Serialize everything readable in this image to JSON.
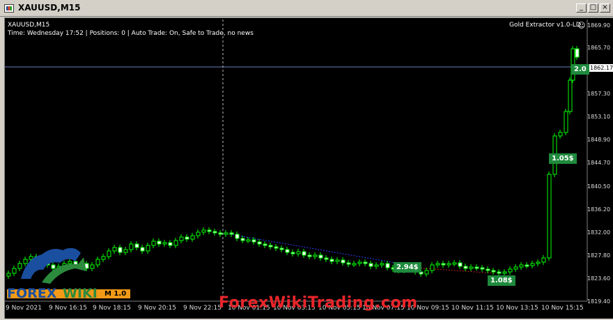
{
  "window": {
    "title": "XAUUSD,M15",
    "min_label": "_",
    "max_label": "□",
    "close_label": "×"
  },
  "chart": {
    "symbol_label": "XAUUSD,M15",
    "status_line": "Time: Wednesday 17:52 | Positions: 0 | Auto Trade: On, Safe to Trade, no news",
    "indicator_name": "Gold Extractor v1.0-LD",
    "price_axis": [
      "1869.90",
      "1865.70",
      "1862.1",
      "1857.30",
      "1853.10",
      "1848.90",
      "1844.70",
      "1840.50",
      "1836.20",
      "1832.00",
      "1827.80",
      "1823.60",
      "1819.40"
    ],
    "current_price": "1862.17",
    "time_axis": [
      "9 Nov 2021",
      "9 Nov 16:15",
      "9 Nov 18:15",
      "9 Nov 20:15",
      "9 Nov 22:15",
      "10 Nov 01:15",
      "10 Nov 03:15",
      "10 Nov 05:15",
      "10 Nov 07:15",
      "10 Nov 09:15",
      "10 Nov 11:15",
      "10 Nov 13:15",
      "10 Nov 15:15"
    ],
    "profit_badges": [
      "2.94$",
      "1.08$",
      "1.05$",
      "2.0"
    ],
    "ea_label": "M 1.0",
    "colors": {
      "background": "#000000",
      "bull_candle": "#00ff00",
      "bear_candle": "#ffffff",
      "badge": "#1f8a3d",
      "current_price_line": "#6f7fbf"
    }
  },
  "watermark": {
    "site": "ForexWikiTrading.com",
    "logo_left": "FOREX",
    "logo_right": "WIKI"
  }
}
